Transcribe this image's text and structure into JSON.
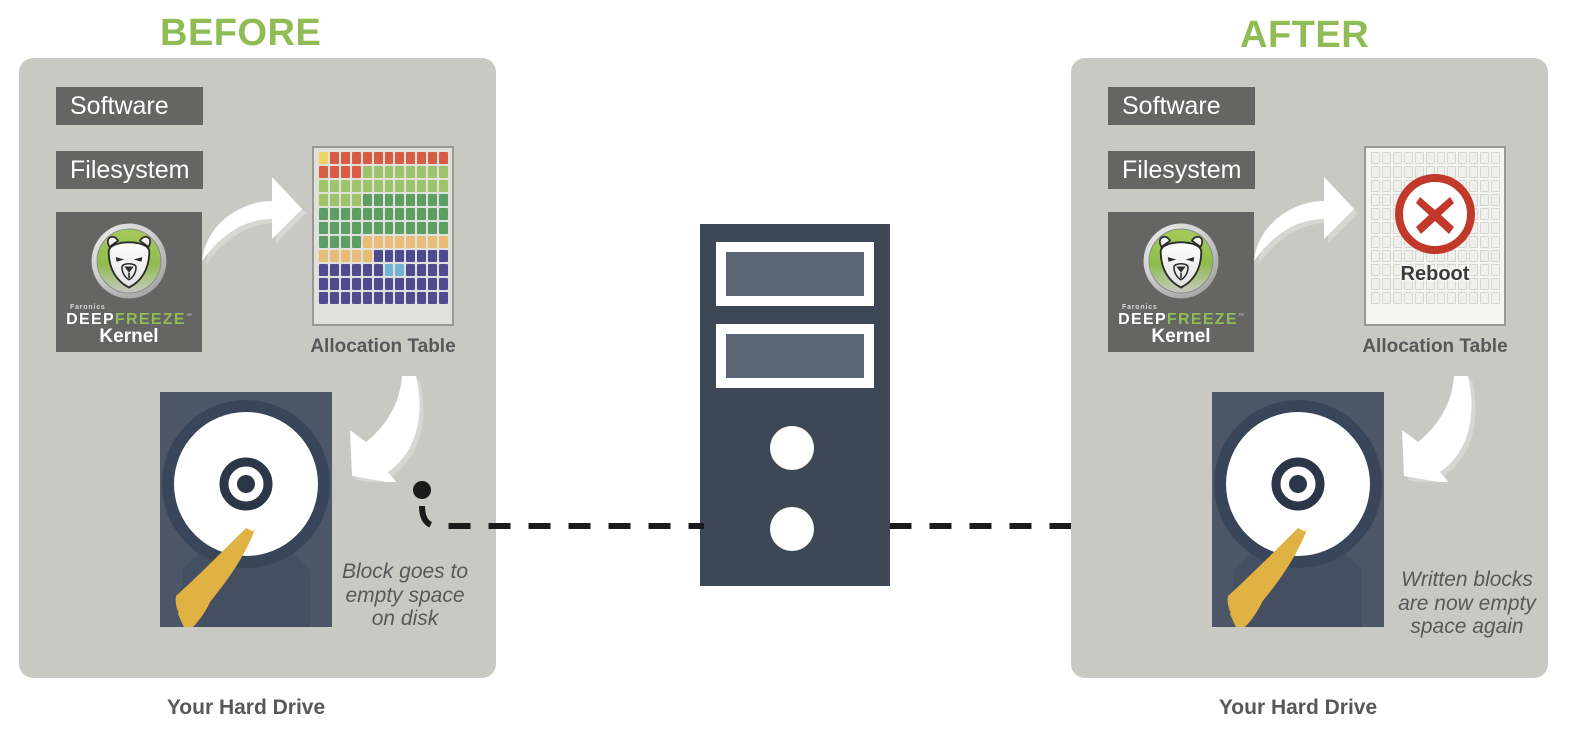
{
  "titles": {
    "before": "BEFORE",
    "after": "AFTER",
    "accent_color": "#8fbc55"
  },
  "before_panel": {
    "stack": [
      {
        "label": "Software"
      },
      {
        "label": "Filesystem"
      }
    ],
    "kernel_card": {
      "brand_small": "Faronics",
      "brand_deep": "DEEP",
      "brand_freeze": "FREEZE",
      "trademark": "™",
      "label": "Kernel",
      "logo_icon": "polar-bear-logo-icon"
    },
    "allocation_table": {
      "caption": "Allocation Table",
      "columns": 12,
      "rows": 11,
      "legend_colors": {
        "yellow": "#ead55f",
        "red": "#d85c44",
        "light_green": "#9dc46b",
        "green": "#5d9e62",
        "orange": "#e9bd78",
        "purple": "#4e4b8e",
        "blue": "#72b4d4"
      },
      "cells": [
        [
          "yellow",
          "red",
          "red",
          "red",
          "red",
          "red",
          "red",
          "red",
          "red",
          "red",
          "red",
          "red"
        ],
        [
          "red",
          "red",
          "red",
          "red",
          "light_green",
          "light_green",
          "light_green",
          "light_green",
          "light_green",
          "light_green",
          "light_green",
          "light_green"
        ],
        [
          "light_green",
          "light_green",
          "light_green",
          "light_green",
          "light_green",
          "light_green",
          "light_green",
          "light_green",
          "light_green",
          "light_green",
          "light_green",
          "light_green"
        ],
        [
          "light_green",
          "light_green",
          "light_green",
          "light_green",
          "green",
          "green",
          "green",
          "green",
          "green",
          "green",
          "green",
          "green"
        ],
        [
          "green",
          "green",
          "green",
          "green",
          "green",
          "green",
          "green",
          "green",
          "green",
          "green",
          "green",
          "green"
        ],
        [
          "green",
          "green",
          "green",
          "green",
          "green",
          "green",
          "green",
          "green",
          "green",
          "green",
          "green",
          "green"
        ],
        [
          "green",
          "green",
          "green",
          "green",
          "orange",
          "orange",
          "orange",
          "orange",
          "orange",
          "orange",
          "orange",
          "orange"
        ],
        [
          "orange",
          "orange",
          "orange",
          "orange",
          "orange",
          "purple",
          "purple",
          "purple",
          "purple",
          "purple",
          "purple",
          "purple"
        ],
        [
          "purple",
          "purple",
          "purple",
          "purple",
          "purple",
          "purple",
          "blue",
          "blue",
          "purple",
          "purple",
          "purple",
          "purple"
        ],
        [
          "purple",
          "purple",
          "purple",
          "purple",
          "purple",
          "purple",
          "purple",
          "purple",
          "purple",
          "purple",
          "purple",
          "purple"
        ],
        [
          "purple",
          "purple",
          "purple",
          "purple",
          "purple",
          "purple",
          "purple",
          "purple",
          "purple",
          "purple",
          "purple",
          "purple"
        ]
      ]
    },
    "hard_drive": {
      "icon": "hard-drive-icon",
      "caption": "Block goes to\nempty space\non disk"
    },
    "bottom_label": "Your Hard Drive",
    "arrows": [
      {
        "name": "arrow-kernel-to-table",
        "direction": "up-right"
      },
      {
        "name": "arrow-table-to-drive",
        "direction": "down-left"
      }
    ]
  },
  "after_panel": {
    "stack": [
      {
        "label": "Software"
      },
      {
        "label": "Filesystem"
      }
    ],
    "kernel_card": {
      "brand_small": "Faronics",
      "brand_deep": "DEEP",
      "brand_freeze": "FREEZE",
      "trademark": "™",
      "label": "Kernel",
      "logo_icon": "polar-bear-logo-icon"
    },
    "allocation_table": {
      "caption": "Allocation Table",
      "columns": 12,
      "rows": 11,
      "state": "empty",
      "empty_cell_color": "#efefeb",
      "reboot": {
        "label": "Reboot",
        "icon": "red-x-circle-icon",
        "icon_color": "#c0392b"
      }
    },
    "hard_drive": {
      "icon": "hard-drive-icon",
      "caption": "Written blocks\nare now empty\nspace again"
    },
    "bottom_label": "Your Hard Drive",
    "arrows": [
      {
        "name": "arrow-kernel-to-table",
        "direction": "up-right"
      },
      {
        "name": "arrow-table-to-drive",
        "direction": "down-left"
      }
    ]
  },
  "center": {
    "tower": {
      "icon": "computer-tower-icon",
      "body_color": "#3e4755",
      "bay_color": "#5a6472"
    },
    "connectors": {
      "left": {
        "name": "dashed-connector-left",
        "dot": true
      },
      "right": {
        "name": "dashed-connector-right",
        "dot": true
      },
      "color": "#1a1a1a"
    }
  }
}
